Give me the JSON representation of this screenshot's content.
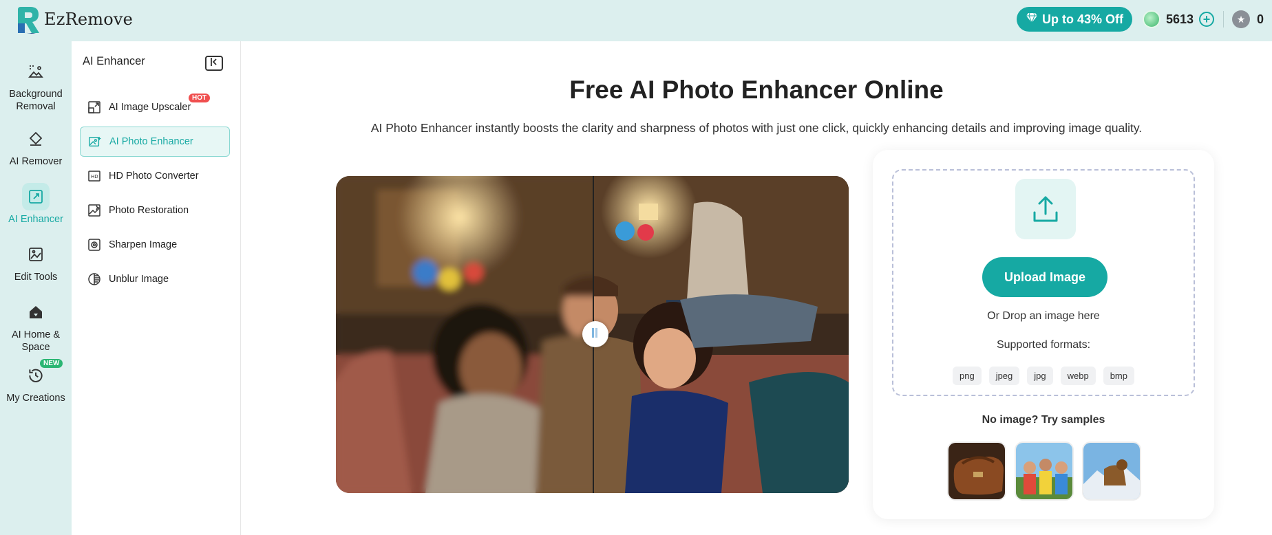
{
  "app": {
    "name": "EzRemove"
  },
  "header": {
    "promo_label": "Up to 43% Off",
    "credits": "5613",
    "stars": "0"
  },
  "rail": {
    "items": [
      {
        "label": "Background Removal",
        "icon": "background-removal-icon"
      },
      {
        "label": "AI Remover",
        "icon": "eraser-icon"
      },
      {
        "label": "AI Enhancer",
        "icon": "enhance-icon",
        "active": true
      },
      {
        "label": "Edit Tools",
        "icon": "image-edit-icon"
      },
      {
        "label": "AI Home & Space",
        "icon": "home-icon"
      },
      {
        "label": "My Creations",
        "icon": "history-icon",
        "badge": "NEW"
      }
    ]
  },
  "panel": {
    "title": "AI Enhancer",
    "items": [
      {
        "label": "AI Image Upscaler",
        "icon": "upscale-icon",
        "badge": "HOT"
      },
      {
        "label": "AI Photo Enhancer",
        "icon": "photo-enhance-icon",
        "active": true
      },
      {
        "label": "HD Photo Converter",
        "icon": "hd-icon"
      },
      {
        "label": "Photo Restoration",
        "icon": "restore-icon"
      },
      {
        "label": "Sharpen Image",
        "icon": "sharpen-icon"
      },
      {
        "label": "Unblur Image",
        "icon": "unblur-icon"
      }
    ]
  },
  "main": {
    "title": "Free AI Photo Enhancer Online",
    "subtitle": "AI Photo Enhancer instantly boosts the clarity and sharpness of photos with just one click, quickly enhancing details and improving image quality."
  },
  "upload": {
    "button_label": "Upload Image",
    "drop_text": "Or Drop an image here",
    "formats_label": "Supported formats:",
    "formats": [
      "png",
      "jpeg",
      "jpg",
      "webp",
      "bmp"
    ],
    "samples_label": "No image? Try samples"
  },
  "colors": {
    "accent": "#16a9a3",
    "rail_bg": "#dcefee",
    "hot": "#f04f4f",
    "new": "#2bb673"
  }
}
